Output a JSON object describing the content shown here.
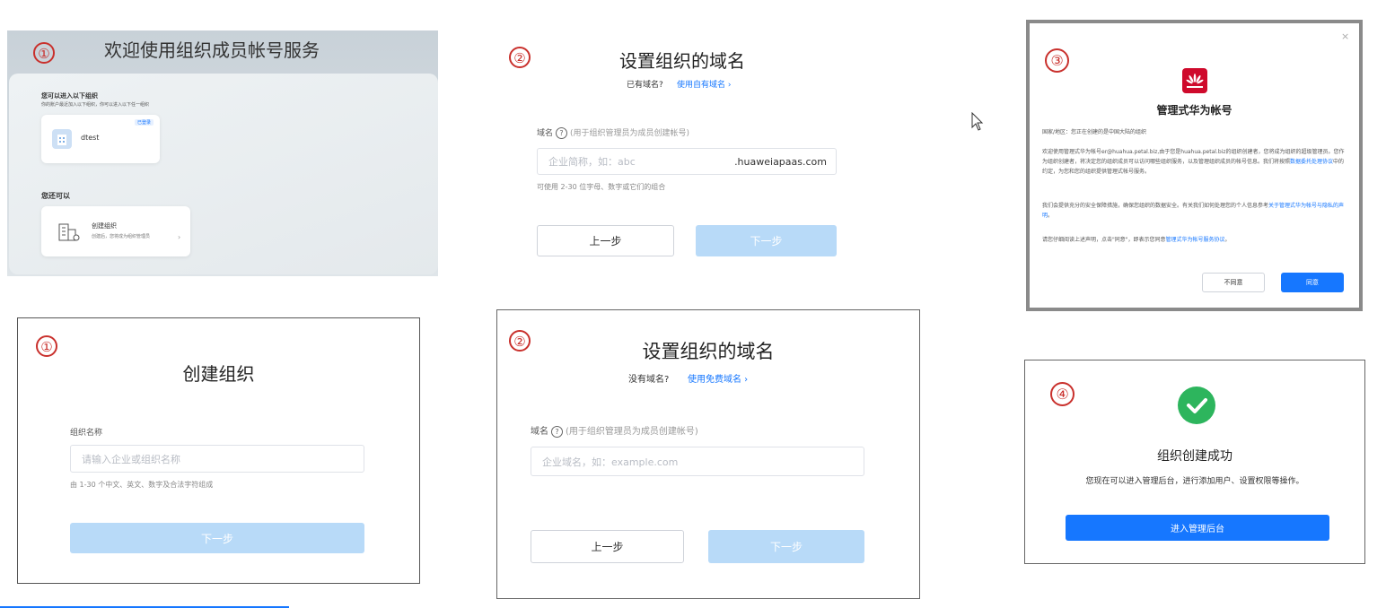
{
  "panel1_top": {
    "step": "①",
    "title": "欢迎使用组织成员帐号服务",
    "join_heading": "您可以进入以下组织",
    "join_desc": "你的账户最近加入以下组织，你可以进入以下任一组织",
    "org_name": "dtest",
    "org_badge": "已登录",
    "also_heading": "您还可以",
    "create_title": "创建组织",
    "create_desc": "创建后，您将成为组织管理员",
    "create_arrow": "›"
  },
  "panel2_top": {
    "step": "②",
    "title": "设置组织的域名",
    "has_domain_text": "已有域名?",
    "has_domain_link": "使用自有域名 ›",
    "field_label": "域名",
    "field_hint": "(用于组织管理员为成员创建帐号)",
    "input_placeholder": "企业简称，如：abc",
    "input_suffix": ".huaweiapaas.com",
    "input_note": "可使用 2-30 位字母、数字或它们的组合",
    "prev_label": "上一步",
    "next_label": "下一步"
  },
  "panel3": {
    "step": "③",
    "close_icon": "×",
    "title": "管理式华为帐号",
    "region_line": "国家/地区：您正在创建的是中国大陆的组织",
    "para1_text": "欢迎使用管理式华为帐号er@huahua.petal.biz,由于您是huahua.petal.biz的组织创建者，您将成为组织的超级管理员。您作为组织创建者，将决定您的组织成员可以访问哪些组织服务，以及管理组织成员的帐号信息。我们将按照",
    "para1_link": "数据委托处理协议",
    "para1_tail": "中的约定，为您和您的组织提供管理式帐号服务。",
    "para2_text": "我们会提供充分的安全保障措施，确保您组织的数据安全。有关我们如何处理您的个人信息参考",
    "para2_link": "关于管理式华为帐号与隐私的声明",
    "para2_tail": "。",
    "para3_text": "请您仔细阅读上述声明，点击\"同意\"，即表示您同意",
    "para3_link": "管理式华为帐号服务协议",
    "para3_tail": "。",
    "decline_label": "不同意",
    "agree_label": "同意"
  },
  "panel1_bottom": {
    "step": "①",
    "title": "创建组织",
    "field_label": "组织名称",
    "input_placeholder": "请输入企业或组织名称",
    "input_note": "由 1-30 个中文、英文、数字及合法字符组成",
    "next_label": "下一步"
  },
  "panel2_bottom": {
    "step": "②",
    "title": "设置组织的域名",
    "no_domain_text": "没有域名?",
    "no_domain_link": "使用免费域名 ›",
    "field_label": "域名",
    "field_hint": "(用于组织管理员为成员创建帐号)",
    "input_placeholder": "企业域名，如：example.com",
    "prev_label": "上一步",
    "next_label": "下一步"
  },
  "panel4": {
    "step": "④",
    "title": "组织创建成功",
    "desc": "您现在可以进入管理后台，进行添加用户、设置权限等操作。",
    "button_label": "进入管理后台"
  },
  "colors": {
    "step_red": "#c9302c",
    "primary_blue": "#1677ff",
    "disabled_blue": "#b8daf8",
    "success_green": "#2db55d",
    "huawei_red": "#cf0a2c"
  }
}
